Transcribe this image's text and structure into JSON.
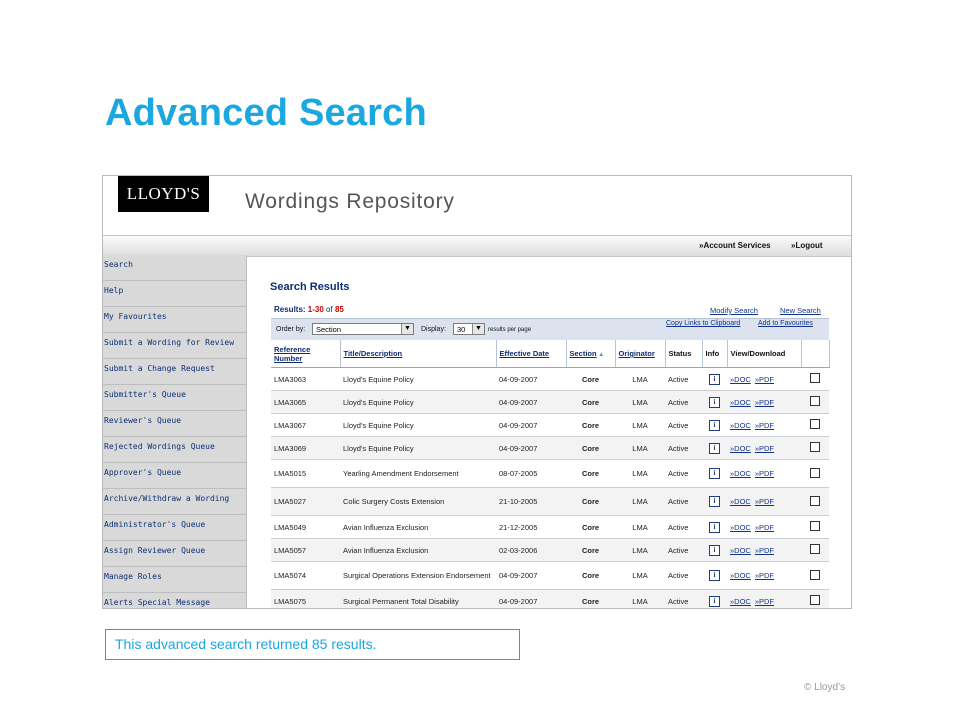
{
  "slide": {
    "title": "Advanced Search",
    "caption": "This advanced search returned 85 results.",
    "copyright": "© Lloyd’s",
    "accent_color": "#1ba7df"
  },
  "app": {
    "logo_text": "LLOYD'S",
    "title": "Wordings Repository",
    "nav_links": [
      "»Account Services",
      "»Logout"
    ]
  },
  "sidebar": {
    "items": [
      "Search",
      "Help",
      "My Favourites",
      "Submit a Wording for Review",
      "Submit a Change Request",
      "Submitter's Queue",
      "Reviewer's Queue",
      "Rejected Wordings Queue",
      "Approver's Queue",
      "Archive/Withdraw a Wording",
      "Administrator's Queue",
      "Assign Reviewer Queue",
      "Manage Roles",
      "Alerts Special Message"
    ]
  },
  "results": {
    "heading": "Search Results",
    "label": "Results:",
    "range": "1-30",
    "of": "of",
    "total": "85",
    "modify_search": "Modify Search",
    "new_search": "New Search",
    "order_by_label": "Order by:",
    "order_by_value": "Section",
    "display_label": "Display:",
    "display_value": "30",
    "per_page": "results per page",
    "copy_links": "Copy Links to Clipboard",
    "add_favourites": "Add to Favourites",
    "columns": [
      "Reference Number",
      "Title/Description",
      "Effective Date",
      "Section",
      "Originator",
      "Status",
      "Info",
      "View/Download",
      ""
    ],
    "doc_label": "»DOC",
    "pdf_label": "»PDF",
    "rows": [
      {
        "ref": "LMA3063",
        "title": "Lloyd's Equine Policy",
        "date": "04-09-2007",
        "section": "Core",
        "originator": "LMA",
        "status": "Active"
      },
      {
        "ref": "LMA3065",
        "title": "Lloyd's Equine Policy",
        "date": "04-09-2007",
        "section": "Core",
        "originator": "LMA",
        "status": "Active"
      },
      {
        "ref": "LMA3067",
        "title": "Lloyd's Equine Policy",
        "date": "04-09-2007",
        "section": "Core",
        "originator": "LMA",
        "status": "Active"
      },
      {
        "ref": "LMA3069",
        "title": "Lloyd's Equine Policy",
        "date": "04-09-2007",
        "section": "Core",
        "originator": "LMA",
        "status": "Active"
      },
      {
        "ref": "LMA5015",
        "title": "Yearling Amendment Endorsement",
        "date": "08-07-2005",
        "section": "Core",
        "originator": "LMA",
        "status": "Active"
      },
      {
        "ref": "LMA5027",
        "title": "Colic Surgery Costs Extension",
        "date": "21-10-2005",
        "section": "Core",
        "originator": "LMA",
        "status": "Active"
      },
      {
        "ref": "LMA5049",
        "title": "Avian Influenza Exclusion",
        "date": "21-12-2005",
        "section": "Core",
        "originator": "LMA",
        "status": "Active"
      },
      {
        "ref": "LMA5057",
        "title": "Avian Influenza Exclusion",
        "date": "02-03-2006",
        "section": "Core",
        "originator": "LMA",
        "status": "Active"
      },
      {
        "ref": "LMA5074",
        "title": "Surgical Operations Extension Endorsement",
        "date": "04-09-2007",
        "section": "Core",
        "originator": "LMA",
        "status": "Active"
      },
      {
        "ref": "LMA5075",
        "title": "Surgical Permanent Total Disability",
        "date": "04-09-2007",
        "section": "Core",
        "originator": "LMA",
        "status": "Active"
      }
    ]
  }
}
